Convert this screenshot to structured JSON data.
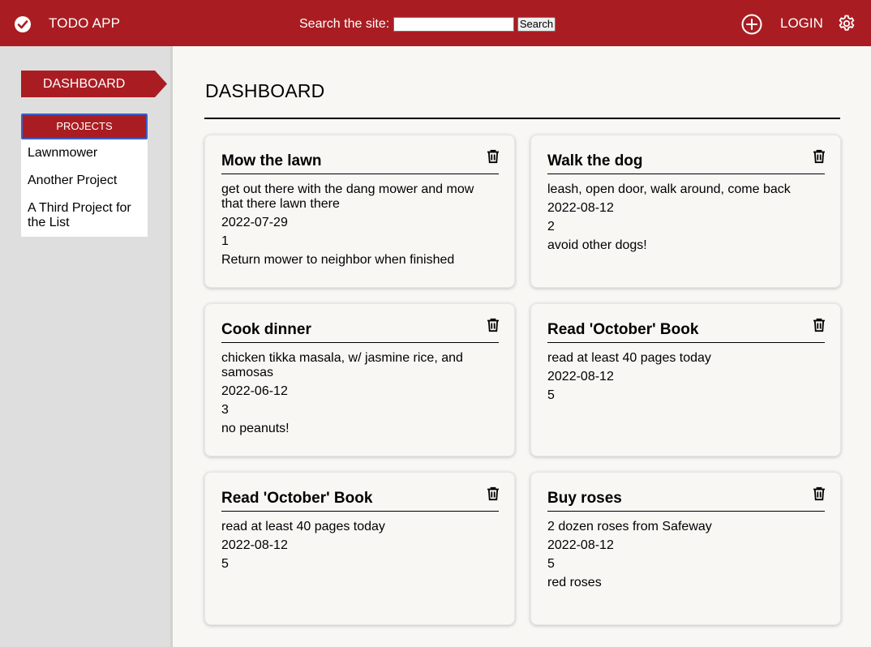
{
  "header": {
    "app_title": "TODO APP",
    "search_label": "Search the site:",
    "search_value": "",
    "search_button": "Search",
    "login_label": "LOGIN",
    "icons": [
      "check-circle-icon",
      "plus-circle-icon",
      "gear-icon"
    ]
  },
  "sidebar": {
    "dashboard_label": "DASHBOARD",
    "projects_label": "PROJECTS",
    "projects": [
      "Lawnmower",
      "Another Project",
      "A Third Project for the List"
    ]
  },
  "main": {
    "title": "DASHBOARD",
    "cards": [
      {
        "title": "Mow the lawn",
        "description": "get out there with the dang mower and mow that there lawn there",
        "date": "2022-07-29",
        "priority": "1",
        "notes": "Return mower to neighbor when finished"
      },
      {
        "title": "Walk the dog",
        "description": "leash, open door, walk around, come back",
        "date": "2022-08-12",
        "priority": "2",
        "notes": "avoid other dogs!"
      },
      {
        "title": "Cook dinner",
        "description": "chicken tikka masala, w/ jasmine rice, and samosas",
        "date": "2022-06-12",
        "priority": "3",
        "notes": "no peanuts!"
      },
      {
        "title": "Read 'October' Book",
        "description": "read at least 40 pages today",
        "date": "2022-08-12",
        "priority": "5",
        "notes": ""
      },
      {
        "title": "Read 'October' Book",
        "description": "read at least 40 pages today",
        "date": "2022-08-12",
        "priority": "5",
        "notes": ""
      },
      {
        "title": "Buy roses",
        "description": "2 dozen roses from Safeway",
        "date": "2022-08-12",
        "priority": "5",
        "notes": "red roses"
      }
    ]
  },
  "colors": {
    "accent": "#a91d22",
    "sidebar_bg": "#dedede",
    "page_bg": "#f8f7f4",
    "focus_ring": "#3b5ec7"
  }
}
